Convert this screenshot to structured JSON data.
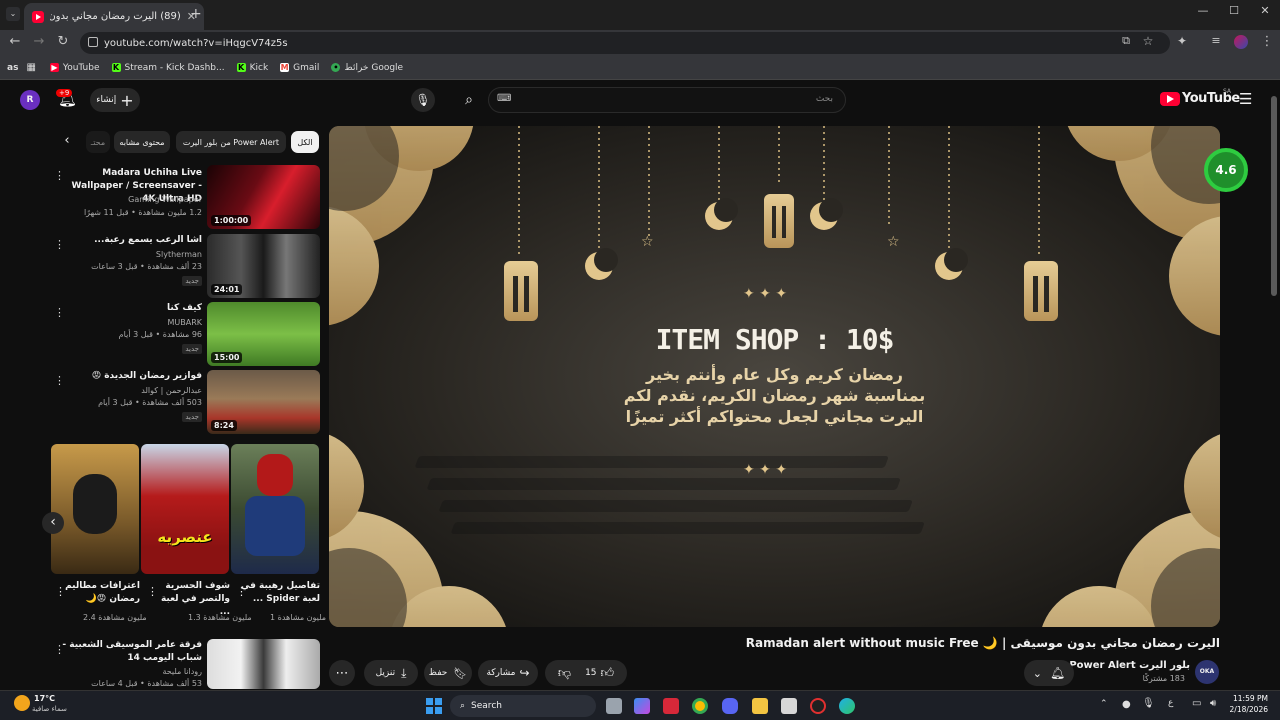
{
  "browser": {
    "tab_title": "(89) اليرت رمضان مجاني بدون موسيقى",
    "url": "youtube.com/watch?v=iHqgcV74z5s",
    "profile_badge": "as",
    "bookmarks": [
      {
        "label": "YouTube",
        "color": "#ff0033"
      },
      {
        "label": "Stream - Kick Dashb...",
        "color": "#53fc18"
      },
      {
        "label": "Kick",
        "color": "#53fc18"
      },
      {
        "label": "Gmail",
        "color": "#ea4335"
      },
      {
        "label": "خرائط Google",
        "color": "#34a853"
      }
    ]
  },
  "youtube": {
    "logo_text": "YouTube",
    "region": "SA",
    "search_placeholder": "بحث",
    "keyboard_icon_text": "⌨",
    "notifications_count": "+9",
    "create_label": "إنشاء",
    "avatar_letter": "R"
  },
  "chips": [
    "الكل",
    "من Power Alert",
    "بلور اليرت",
    "محتوى مشابه",
    "محتـ"
  ],
  "recommendations": [
    {
      "title": "Madara Uchiha Live Wallpaper / Screensaver - 4K Ultra HD",
      "channel": "Gaming Wallpaper",
      "meta": "1.2 مليون مشاهدة • قبل 11 شهرًا",
      "duration": "1:00:00",
      "badge": ""
    },
    {
      "title": "اشا الرعب يسمع رعبة...",
      "channel": "Slytherman",
      "meta": "23 ألف مشاهدة • قبل 3 ساعات",
      "duration": "24:01",
      "badge": "جديد"
    },
    {
      "title": "كيف كنا",
      "channel": "MUBARK",
      "meta": "96 مشاهدة • قبل 3 أيام",
      "duration": "15:00",
      "badge": "جديد"
    },
    {
      "title": "فوازير رمضان الجديدة 😡",
      "channel": "عبدالرحمن | كوالد",
      "meta": "503 ألف مشاهدة • قبل 3 أيام",
      "duration": "8:24",
      "badge": "جديد"
    },
    {
      "title": "فرقة عامر الموسيقى الشعبية - شباب اليومب 14",
      "channel": "رودانا مليحة",
      "meta": "53 ألف مشاهدة • قبل 4 ساعات",
      "duration": "",
      "badge": ""
    }
  ],
  "shorts": [
    {
      "title": "اعترافات مطاليم رمضان 😡🌙",
      "views": "2.4 مليون مشاهدة",
      "caption": ""
    },
    {
      "title": "شوف الحسرية والتصر في لعبة ...",
      "views": "1.3 مليون مشاهدة",
      "caption": "عنصريه"
    },
    {
      "title": "تفاصيل رهيبة في لعبة Spider ...",
      "views": "1 مليون مشاهدة",
      "caption": ""
    }
  ],
  "video": {
    "overlay_heading": "ITEM SHOP : 10$",
    "overlay_lines": [
      "رمضان كريم وكل عام وأنتم بخير",
      "بمناسبة شهر رمضان الكريم، نقدم لكم",
      "اليرت مجاني لجعل محتواكم أكثر تميزًا"
    ],
    "rating": "4.6",
    "title": "اليرت رمضان مجاني بدون موسيقى | 🌙 Ramadan alert without music Free",
    "channel": "بلور اليرت Power Alert",
    "subscribers": "183 مشتركًا",
    "channel_avatar": "OKA",
    "likes": "15",
    "share_label": "مشاركة",
    "save_label": "حفظ",
    "download_label": "تنزيل"
  },
  "taskbar": {
    "weather_temp": "17°C",
    "weather_desc": "سماء صافية",
    "search_label": "Search",
    "time": "11:59 PM",
    "date": "2/18/2026",
    "lang": "ع"
  }
}
